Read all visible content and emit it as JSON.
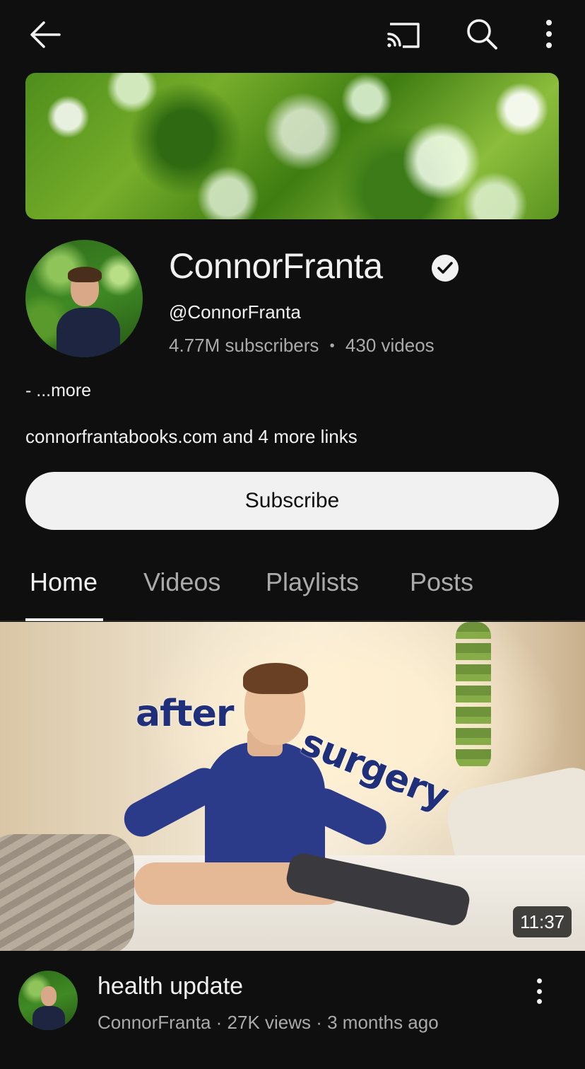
{
  "topbar": {
    "back_icon": "back-arrow-icon",
    "cast_icon": "cast-icon",
    "search_icon": "search-icon",
    "menu_icon": "more-vert-icon"
  },
  "channel": {
    "name": "ConnorFranta",
    "verified": true,
    "handle": "@ConnorFranta",
    "subscribers": "4.77M subscribers",
    "separator": "•",
    "videos": "430 videos",
    "description_more": "- ...more",
    "links": "connorfrantabooks.com and 4 more links",
    "subscribe_label": "Subscribe"
  },
  "tabs": [
    {
      "label": "Home",
      "active": true
    },
    {
      "label": "Videos",
      "active": false
    },
    {
      "label": "Playlists",
      "active": false
    },
    {
      "label": "Posts",
      "active": false
    }
  ],
  "featured_video": {
    "thumbnail_text_1": "after",
    "thumbnail_text_2": "surgery",
    "duration": "11:37",
    "title": "health update",
    "meta": "ConnorFranta · 27K views · 3 months ago"
  },
  "colors": {
    "background": "#0f0f0f",
    "text_primary": "#f1f1f1",
    "text_secondary": "#aaaaaa",
    "subscribe_bg": "#f1f1f1"
  }
}
